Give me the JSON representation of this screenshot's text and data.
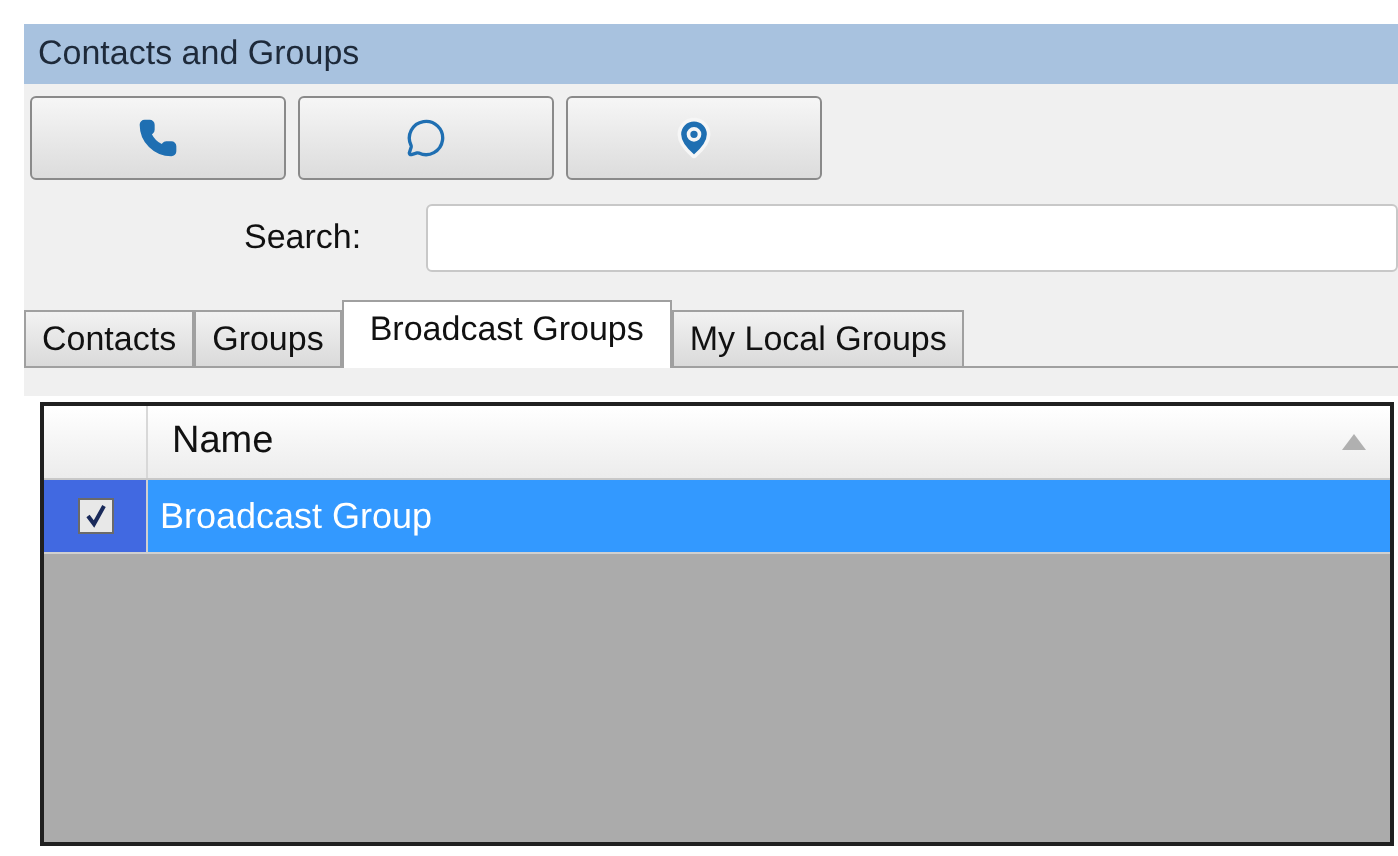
{
  "window": {
    "title": "Contacts and Groups"
  },
  "search": {
    "label": "Search:"
  },
  "tabs": [
    {
      "label": "Contacts",
      "selected": false
    },
    {
      "label": "Groups",
      "selected": false
    },
    {
      "label": "Broadcast Groups",
      "selected": true
    },
    {
      "label": "My Local Groups",
      "selected": false
    }
  ],
  "table": {
    "columns": [
      "Name"
    ],
    "rows": [
      {
        "name": "Broadcast Group",
        "checked": true,
        "selected": true
      }
    ]
  }
}
